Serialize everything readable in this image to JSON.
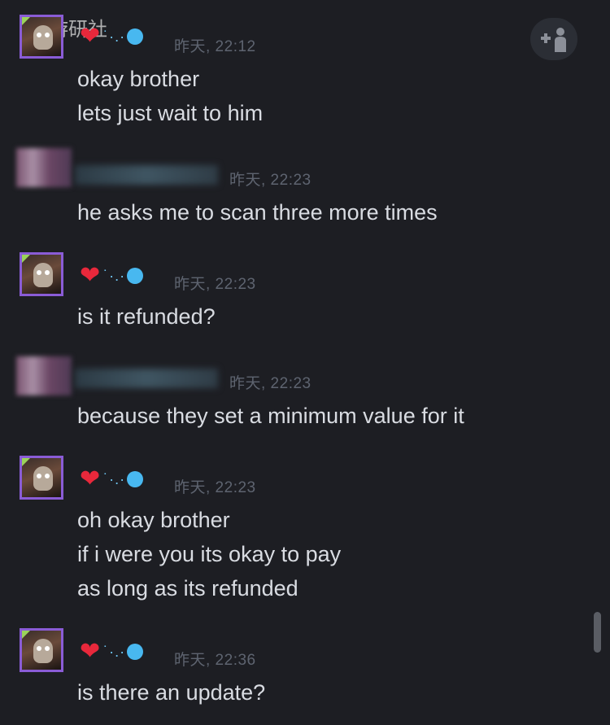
{
  "watermark": "游研社",
  "header": {
    "add_friend_icon": "add-person-icon"
  },
  "messages": [
    {
      "sender": "self",
      "name_decoration": [
        "heart",
        "dots",
        "ball"
      ],
      "time": "昨天, 22:12",
      "lines": [
        "okay brother",
        "lets just wait to him"
      ]
    },
    {
      "sender": "other",
      "time": "昨天, 22:23",
      "lines": [
        "he asks me to scan three more times"
      ]
    },
    {
      "sender": "self",
      "name_decoration": [
        "heart",
        "dots",
        "ball"
      ],
      "time": "昨天, 22:23",
      "lines": [
        "is it refunded?"
      ]
    },
    {
      "sender": "other",
      "time": "昨天, 22:23",
      "lines": [
        "because they set a minimum value for it"
      ]
    },
    {
      "sender": "self",
      "name_decoration": [
        "heart",
        "dots",
        "ball"
      ],
      "time": "昨天, 22:23",
      "lines": [
        "oh okay brother",
        "if i were you its okay to pay",
        "as long as its refunded"
      ]
    },
    {
      "sender": "self",
      "name_decoration": [
        "heart",
        "dots",
        "ball"
      ],
      "time": "昨天, 22:36",
      "lines": [
        "is there an update?"
      ]
    }
  ],
  "colors": {
    "background": "#1d1e23",
    "text": "#d9dce2",
    "timestamp": "#5e6470",
    "heart": "#e8283b",
    "status_dot": "#48b8f0",
    "avatar_border": "#8a5cd6"
  }
}
